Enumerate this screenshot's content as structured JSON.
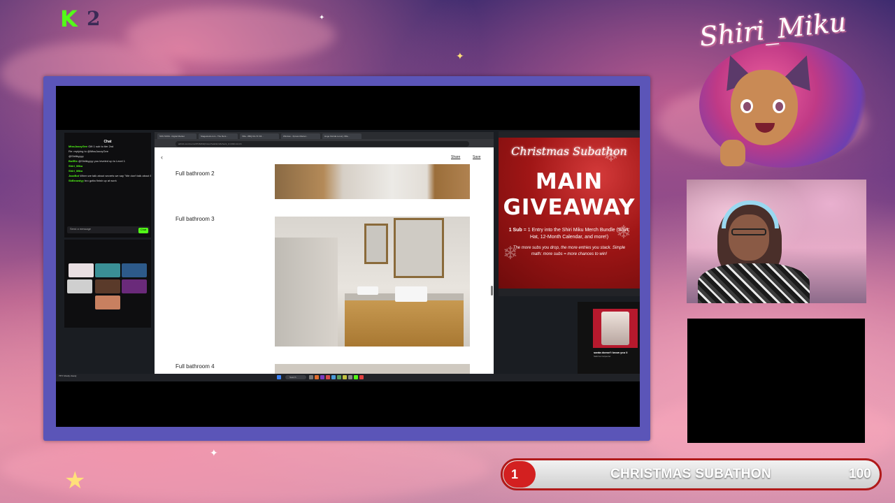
{
  "overlay": {
    "logo_k": "K",
    "logo_2": "2",
    "streamer_name": "Shiri_Miku",
    "subathon": {
      "title": "CHRISTMAS SUBATHON",
      "current": "1",
      "goal": "100",
      "progress_fraction": 0.01,
      "accent_color": "#d32020"
    }
  },
  "chat": {
    "title": "Chat",
    "messages": [
      {
        "user": "MissJazzyGee",
        "text": "Gift 1 sub to tier 2nd"
      },
      {
        "user": "",
        "text": "Re: replying to @MissJazzyGee"
      },
      {
        "user": "",
        "text": "@Shiiikyyyy"
      },
      {
        "user": "BotRix",
        "text": "@Shiiikyyyy you leveled up to Level 1"
      },
      {
        "user": "Shiri_Miku",
        "text": ""
      },
      {
        "user": "Shiri_Miku",
        "text": ""
      },
      {
        "user": "JazzBot",
        "text": "When we talk about secrets we say \"We don't talk about Bruno\""
      },
      {
        "user": "SkBrowdyy",
        "text": "bro gotta finish up at work"
      }
    ],
    "input_placeholder": "Send a message",
    "send_label": "Chat"
  },
  "browser": {
    "tabs": [
      "SSS SSSS - Digital Market",
      "Stagestock.com - The Rent...",
      "Villa - 8BQ 0U-72 Vill...",
      "Window - Xpress Mantel...",
      "Huge Florida Luxury Villa..."
    ],
    "url": "airbnb.com/rooms/9746460/photos?adults=2&check_in=2024-12-16",
    "share_label": "Share",
    "save_label": "Save",
    "rooms": [
      "Full bathroom 2",
      "Full bathroom 3",
      "Full bathroom 4"
    ]
  },
  "giveaway": {
    "script_title": "Christmas Subathon",
    "main_line1": "MAIN",
    "main_line2": "GIVEAWAY",
    "body_bold": "1 Sub",
    "body_text": " = 1 Entry into the Shiri Miku Merch Bundle (Shirt, Hat, 12-Month Calendar, and more!)",
    "italic_text": "The more subs you drop, the more entries you stack. Simple math: more subs = more chances to win!"
  },
  "music": {
    "song": "santa doesn't know you li",
    "artist": "Sabrina Carpenter"
  },
  "taskbar": {
    "search_label": "Search",
    "weather": "76°F Mostly cloudy"
  },
  "colors": {
    "frame": "#5b55b8",
    "kick_green": "#53fc18",
    "giveaway_red": "#a01616"
  }
}
